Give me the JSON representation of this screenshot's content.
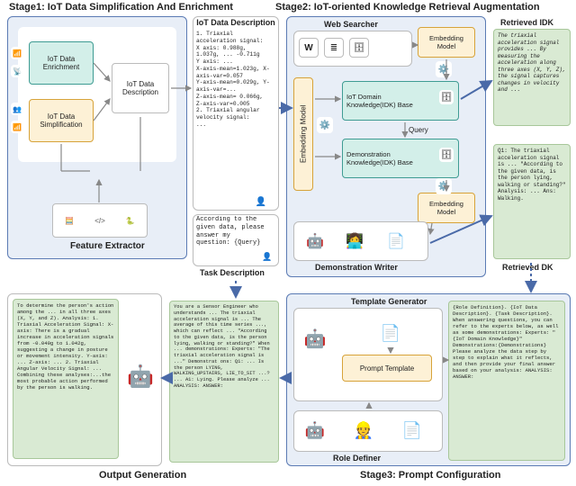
{
  "stage1": {
    "title": "Stage1: IoT Data Simplification And Enrichment",
    "enrichment_label": "IoT Data Enrichment",
    "simplification_label": "IoT Data Simplification",
    "description_label": "IoT Data Description",
    "feature_extractor_label": "Feature Extractor",
    "iot_description_heading": "IoT Data Description",
    "iot_description_text": "1. Triaxial\nacceleration signal:\nX axis: 0.988g,\n1.037g, ... -0.711g\nY axis: ...\nX-axis-mean=1.023g, X-\naxis-var=0.057\nY-axis-mean=0.029g, Y-\naxis-var=...\nZ-axis-mean= 0.066g,\nZ-axis-var=0.005\n2. Triaxial angular\nvelocity signal:\n...",
    "task_description_heading": "Task Description",
    "task_description_text": "According to the\ngiven data, please\nanswer my\nquestion: {Query}"
  },
  "stage2": {
    "title": "Stage2: IoT-oriented Knowledge Retrieval Augmentation",
    "web_searcher_label": "Web Searcher",
    "embedding_model_a": "Embedding Model",
    "embedding_model_b": "Embedding Model",
    "embedding_model_c": "Embedding Model",
    "idk_base_label": "IoT Domain Knowledge(IDK) Base",
    "demo_base_label": "Demonstration Knowledge(IDK) Base",
    "query_label": "Query",
    "demo_writer_label": "Demonstration Writer",
    "retrieved_idk_heading": "Retrieved IDK",
    "retrieved_idk_text": "The triaxial acceleration signal provides ... By measuring the acceleration along three axes (X, Y, Z), the signal captures changes in velocity and ...",
    "retrieved_dk_heading": "Retrieved DK",
    "retrieved_dk_text": "Q1:\n  The triaxial acceleration signal is ...\n  \"According to the given data, is the person lying, walking or standing?\"\n  Analysis: ...\n  Ans: Walking."
  },
  "stage3": {
    "title": "Stage3: Prompt Configuration",
    "template_generator_label": "Template Generator",
    "prompt_template_label": "Prompt Template",
    "role_definer_label": "Role Definer",
    "template_text": "{Role Definition}.\n{IoT Data Description}.\n{Task Description}.\nWhen answering questions, you can refer to the experts below, as well as some demonstrations:\nExperts: \"{IoT Domain Knowledge}\"\nDemonstrations:{Demonstrations}\nPlease analyze the data step by step to explain what it reflects, and then provide your final answer based on your analysis:\nANALYSIS:\nANSWER:",
    "role_text": "You are a Sensor Engineer who understands ...\n  The triaxial acceleration signal is ...\nThe average of this time series ..., which can reflect ...\n  \"According to the given data, is the person lying, walking or standing?\"\n  When ... demonstrations:\nExperts: \"The triaxial acceleration signal is ...\"\n\nDemonstrat ons:\nQ1: ... Is the person LYING, WALKING_UPSTAIRS, LIE_TO_SIT ...?\n...\nA1: Lying.\n\nPlease analyze ...\nANALYSIS:\nANSWER:"
  },
  "output": {
    "heading": "Output Generation",
    "text": "To determine the person's action among the ... in all three axes (X, Y, and Z).\nAnalysis:\n1. Triaxial Acceleration Signal:\nX-axis: There is a gradual increase in acceleration signals from -0.049g to 1.042g, suggesting a change in posture or movement intensity.\nY-axis: ...\nZ-axis: ...\n2. Triaxial Angular Velocity Signal: ...\nCombining these analyses:...the most probable action performed by the person is walking."
  },
  "icons": {
    "signal": "📶",
    "wifi": "📡",
    "people": "👥",
    "calculator": "🧮",
    "code": "</>",
    "python": "🐍",
    "head": "👤",
    "wiki": "W",
    "list": "≣",
    "db": "🗄",
    "gears": "⚙️",
    "bot": "🤖",
    "doc": "📄"
  },
  "colors": {
    "stage1_border": "#5b7bb4",
    "stage1_fill": "#e8eef7",
    "stage2_border": "#5b7bb4",
    "stage3_border": "#5b7bb4",
    "white_box": "#ffffff",
    "yellow_box_border": "#d7a33a",
    "yellow_box_fill": "#fdf1d6",
    "teal_box_border": "#3f9c93",
    "teal_box_fill": "#d3efe9",
    "green_card": "#d9ead3"
  }
}
